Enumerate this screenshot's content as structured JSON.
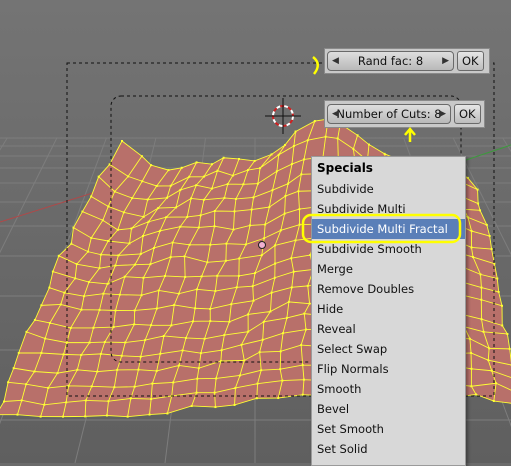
{
  "viewport": {
    "background": "#6b6b6b",
    "mesh_face_color": "#b8706a",
    "wire_color": "#ffff33"
  },
  "rand_popup": {
    "label": "Rand fac: 8",
    "ok": "OK"
  },
  "cuts_popup": {
    "label": "Number of Cuts: 8",
    "ok": "OK"
  },
  "specials": {
    "title": "Specials",
    "items": [
      "Subdivide",
      "Subdivide Multi",
      "Subdivide Multi Fractal",
      "Subdivide Smooth",
      "Merge",
      "Remove Doubles",
      "Hide",
      "Reveal",
      "Select Swap",
      "Flip Normals",
      "Smooth",
      "Bevel",
      "Set Smooth",
      "Set Solid"
    ],
    "active_index": 2,
    "highlight_color": "#5a7fb8"
  },
  "annotation_color": "#ffff00"
}
